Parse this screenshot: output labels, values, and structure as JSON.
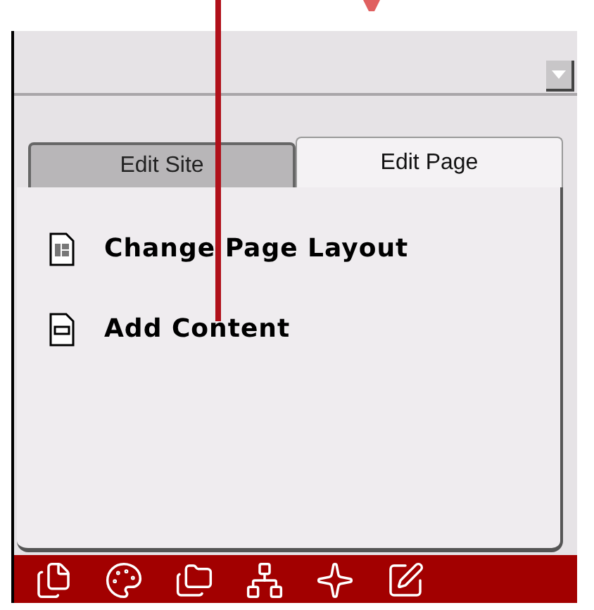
{
  "tabs": [
    {
      "label": "Edit Site",
      "selected": false
    },
    {
      "label": "Edit Page",
      "selected": true
    }
  ],
  "items": [
    {
      "label": "Change Page Layout",
      "kind": "layout"
    },
    {
      "label": "Add Content",
      "kind": "content"
    }
  ]
}
